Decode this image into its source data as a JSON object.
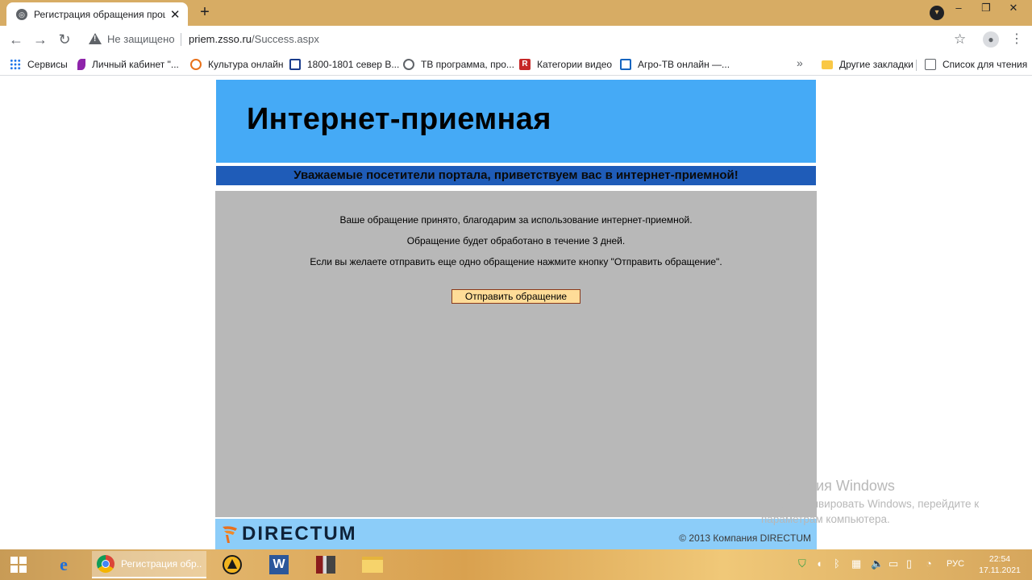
{
  "browser": {
    "tab_title": "Регистрация обращения прош",
    "tab_close": "✕",
    "new_tab": "+",
    "security_text": "Не защищено",
    "url_host": "priem.zsso.ru",
    "url_path": "/Success.aspx"
  },
  "bookmarks": [
    {
      "label": "Сервисы",
      "icon": "apps-grid-icon"
    },
    {
      "label": "Личный кабинет \"...",
      "icon": "feather-icon",
      "color": "#8e24aa"
    },
    {
      "label": "Культура онлайн",
      "icon": "culture-icon",
      "color": "#e8711a"
    },
    {
      "label": "1800-1801 север В...",
      "icon": "calendar-icon",
      "color": "#1a3c8c"
    },
    {
      "label": "ТВ программа, про...",
      "icon": "globe-icon",
      "color": "#5f6368"
    },
    {
      "label": "Категории видео",
      "icon": "r-icon",
      "color": "#c62828"
    },
    {
      "label": "Агро-ТВ онлайн —...",
      "icon": "tv-icon",
      "color": "#1565c0"
    },
    {
      "label": "Другие закладки",
      "icon": "folder-icon",
      "color": "#f9c846"
    },
    {
      "label": "Список для чтения",
      "icon": "reading-list-icon",
      "color": "#5f6368"
    }
  ],
  "bookmarks_more": "»",
  "page": {
    "title": "Интернет-приемная",
    "welcome": "Уважаемые посетители портала, приветствуем вас в интернет-приемной!",
    "messages": [
      "Ваше обращение принято, благодарим за использование интернет-приемной.",
      "Обращение будет обработано в течение 3 дней.",
      "Если вы желаете отправить еще одно обращение нажмите кнопку \"Отправить обращение\"."
    ],
    "send_button": "Отправить обращение",
    "logo_text": "DIRECTUM",
    "copyright": "© 2013 Компания DIRECTUM"
  },
  "watermark": {
    "title": "Активация Windows",
    "line1": "Чтобы активировать Windows, перейдите к",
    "line2": "параметрам компьютера."
  },
  "taskbar": {
    "chrome_label": "Регистрация обр...",
    "word_letter": "W",
    "language": "РУС",
    "time": "22:54",
    "date": "17.11.2021"
  },
  "colors": {
    "header_band": "#45aaf6",
    "welcome_band": "#1f5cb8",
    "content_band": "#b8b8b8",
    "footer_band": "#8ccdf9",
    "button_fill": "#fedc98",
    "tab_strip": "#d7ac64"
  }
}
